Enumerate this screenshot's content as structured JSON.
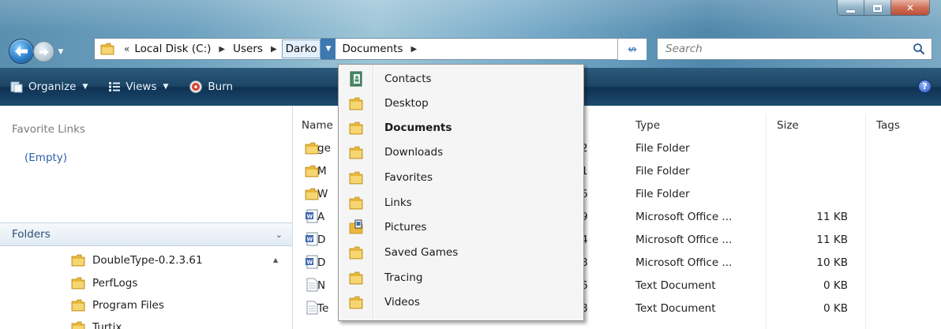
{
  "address": {
    "overflow": "«",
    "crumbs": [
      "Local Disk (C:)",
      "Users",
      "Darko",
      "Documents"
    ]
  },
  "search": {
    "placeholder": "Search"
  },
  "toolbar": {
    "organize": "Organize",
    "views": "Views",
    "burn": "Burn",
    "help": "?"
  },
  "nav": {
    "favorite_links_title": "Favorite Links",
    "favorites_empty": "(Empty)",
    "folders_label": "Folders",
    "tree": [
      "DoubleType-0.2.3.61",
      "PerfLogs",
      "Program Files",
      "Turtix"
    ]
  },
  "columns": {
    "name": "Name",
    "type": "Type",
    "size": "Size",
    "tags": "Tags"
  },
  "rows": [
    {
      "icon": "folder-icon",
      "name_fragment": "ge",
      "date_fragment": "2",
      "type": "File Folder",
      "size": ""
    },
    {
      "icon": "folder-icon",
      "name_fragment": "M",
      "date_fragment": "1",
      "type": "File Folder",
      "size": ""
    },
    {
      "icon": "folder-icon",
      "name_fragment": "W",
      "date_fragment": "6",
      "type": "File Folder",
      "size": ""
    },
    {
      "icon": "word-document-icon",
      "name_fragment": "A",
      "date_fragment": "9",
      "type": "Microsoft Office ...",
      "size": "11 KB"
    },
    {
      "icon": "word-document-icon",
      "name_fragment": "D",
      "date_fragment": "4",
      "type": "Microsoft Office ...",
      "size": "11 KB"
    },
    {
      "icon": "word-document-icon",
      "name_fragment": "D",
      "date_fragment": "8",
      "type": "Microsoft Office ...",
      "size": "10 KB"
    },
    {
      "icon": "text-document-icon",
      "name_fragment": "N",
      "date_fragment": "6",
      "type": "Text Document",
      "size": "0 KB"
    },
    {
      "icon": "text-document-icon",
      "name_fragment": "Te",
      "date_fragment": "8",
      "type": "Text Document",
      "size": "0 KB"
    }
  ],
  "menu": {
    "items": [
      {
        "label": "Contacts",
        "icon": "contacts-icon"
      },
      {
        "label": "Desktop",
        "icon": "folder-icon"
      },
      {
        "label": "Documents",
        "icon": "folder-icon",
        "current": true
      },
      {
        "label": "Downloads",
        "icon": "folder-icon"
      },
      {
        "label": "Favorites",
        "icon": "folder-icon"
      },
      {
        "label": "Links",
        "icon": "folder-icon"
      },
      {
        "label": "Pictures",
        "icon": "pictures-icon"
      },
      {
        "label": "Saved Games",
        "icon": "folder-icon"
      },
      {
        "label": "Tracing",
        "icon": "folder-icon"
      },
      {
        "label": "Videos",
        "icon": "folder-icon"
      }
    ]
  },
  "colors": {
    "toolbar_bg": "#1b4364",
    "link_blue": "#2b5fa8",
    "folder_yellow": "#e9b83a",
    "close_red": "#c8563c"
  }
}
